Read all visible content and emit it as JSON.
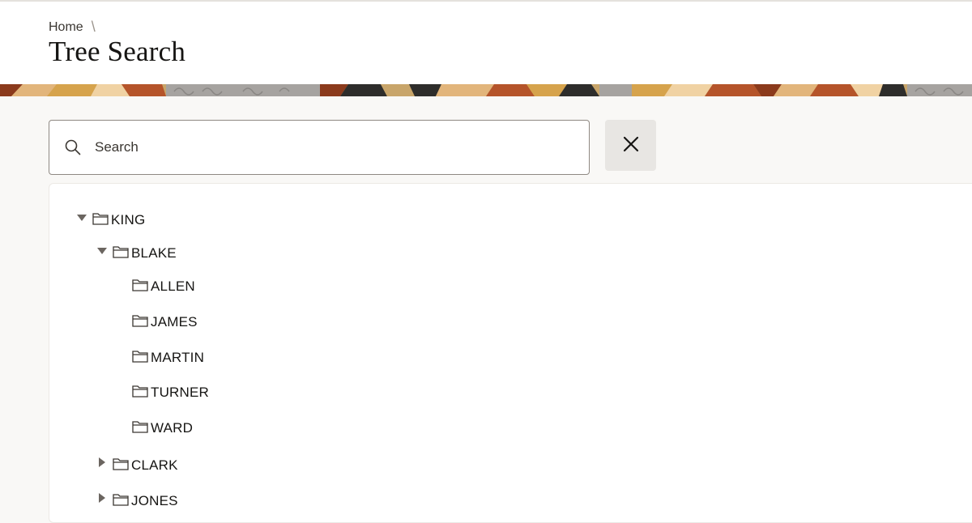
{
  "breadcrumb": {
    "home_label": "Home",
    "separator": "\\"
  },
  "page": {
    "title": "Tree Search"
  },
  "search": {
    "placeholder": "Search",
    "value": ""
  },
  "icons": {
    "search": "search-icon",
    "clear": "close-icon",
    "folder": "folder-icon",
    "expanded": "caret-down-icon",
    "collapsed": "caret-right-icon"
  },
  "colors": {
    "background": "#f9f8f6",
    "header": "#ffffff",
    "text": "#161513",
    "clear_button": "#e8e6e3",
    "banner": [
      "#8b3a1c",
      "#c8a56a",
      "#e2b57b",
      "#2e2d2b",
      "#a6a3a0",
      "#b5542a",
      "#f0d2a3",
      "#d6a34c"
    ]
  },
  "tree": {
    "root": {
      "label": "KING",
      "state": "expanded"
    },
    "blake": {
      "label": "BLAKE",
      "state": "expanded"
    },
    "blake_children": [
      "ALLEN",
      "JAMES",
      "MARTIN",
      "TURNER",
      "WARD"
    ],
    "clark": {
      "label": "CLARK",
      "state": "collapsed"
    },
    "jones": {
      "label": "JONES",
      "state": "collapsed"
    }
  }
}
